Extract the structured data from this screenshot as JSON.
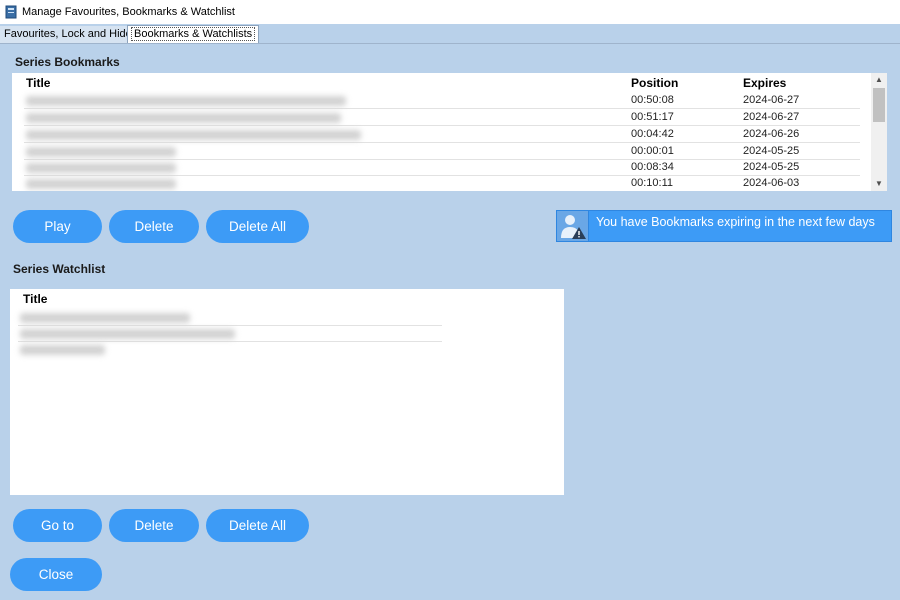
{
  "window": {
    "title": "Manage Favourites, Bookmarks & Watchlist",
    "icon": "app-book-icon"
  },
  "tabs": [
    {
      "label": "Favourites, Lock and Hide",
      "selected": false
    },
    {
      "label": "Bookmarks & Watchlists",
      "selected": true
    }
  ],
  "bookmarks": {
    "title": "Series Bookmarks",
    "columns": [
      "Title",
      "Position",
      "Expires"
    ],
    "rows": [
      {
        "title": "",
        "position": "00:50:08",
        "expires": "2024-06-27"
      },
      {
        "title": "",
        "position": "00:51:17",
        "expires": "2024-06-27"
      },
      {
        "title": "",
        "position": "00:04:42",
        "expires": "2024-06-26"
      },
      {
        "title": "",
        "position": "00:00:01",
        "expires": "2024-05-25"
      },
      {
        "title": "",
        "position": "00:08:34",
        "expires": "2024-05-25"
      },
      {
        "title": "",
        "position": "00:10:11",
        "expires": "2024-06-03"
      }
    ],
    "buttons": {
      "play": "Play",
      "delete": "Delete",
      "delete_all": "Delete All"
    }
  },
  "notice": {
    "text": "You have Bookmarks expiring in the next few days",
    "icon": "user-warning-icon"
  },
  "watchlist": {
    "title": "Series Watchlist",
    "columns": [
      "Title"
    ],
    "rows": [
      {
        "title": ""
      },
      {
        "title": ""
      },
      {
        "title": ""
      }
    ],
    "buttons": {
      "goto": "Go to",
      "delete": "Delete",
      "delete_all": "Delete All"
    }
  },
  "close_label": "Close",
  "colors": {
    "background": "#b9d1ea",
    "button": "#3d9bf6",
    "button_text": "#ffffff",
    "list_bg": "#ffffff"
  }
}
